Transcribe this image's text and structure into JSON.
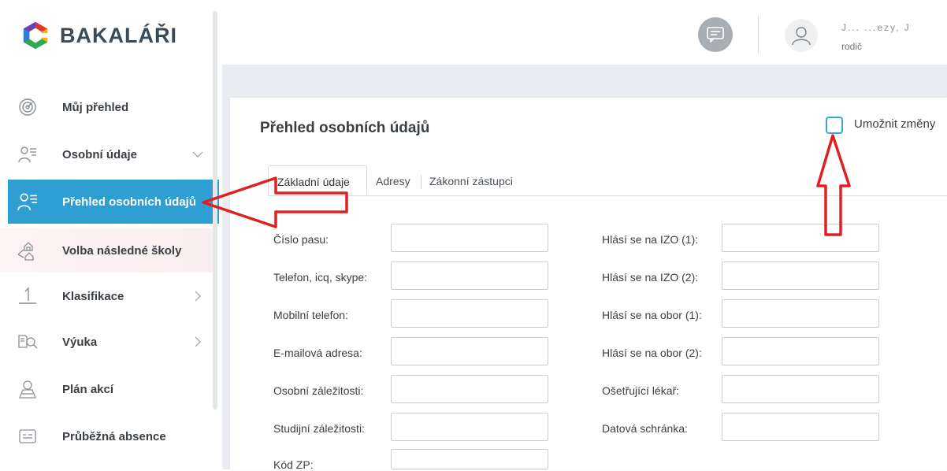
{
  "app": {
    "logo_text": "BAKALÁŘI"
  },
  "sidebar": {
    "items": [
      {
        "label": "Můj přehled",
        "icon": "gauge-icon"
      },
      {
        "label": "Osobní údaje",
        "icon": "person-list-icon"
      },
      {
        "label": "Přehled osobních údajů",
        "icon": "person-list-icon"
      },
      {
        "label": "Volba následné školy",
        "icon": "school-choice-icon"
      },
      {
        "label": "Klasifikace",
        "icon": "grade-one-icon"
      },
      {
        "label": "Výuka",
        "icon": "book-search-icon"
      },
      {
        "label": "Plán akcí",
        "icon": "event-map-icon"
      },
      {
        "label": "Průběžná absence",
        "icon": "absence-card-icon"
      }
    ]
  },
  "header": {
    "user_name": "J... ...ezy, J",
    "user_role": "rodič"
  },
  "card": {
    "title": "Přehled osobních údajů",
    "allow_changes_label": "Umožnit změny",
    "tabs": [
      "Základní údaje",
      "Adresy",
      "Zákonní zástupci"
    ]
  },
  "form": {
    "left": [
      {
        "label": "Číslo pasu:",
        "value": ""
      },
      {
        "label": "Telefon, icq, skype:",
        "value": ""
      },
      {
        "label": "Mobilní telefon:",
        "value": ""
      },
      {
        "label": "E-mailová adresa:",
        "value": ""
      },
      {
        "label": "Osobní záležitosti:",
        "value": ""
      },
      {
        "label": "Studijní záležitosti:",
        "value": ""
      },
      {
        "label": "Kód ZP:",
        "value": ""
      }
    ],
    "right": [
      {
        "label": "Hlásí se na IZO (1):",
        "value": ""
      },
      {
        "label": "Hlásí se na IZO (2):",
        "value": ""
      },
      {
        "label": "Hlásí se na obor (1):",
        "value": ""
      },
      {
        "label": "Hlásí se na obor (2):",
        "value": ""
      },
      {
        "label": "Ošetřující lékař:",
        "value": ""
      },
      {
        "label": "Datová schránka:",
        "value": ""
      }
    ]
  },
  "colors": {
    "accent": "#2e9fd3",
    "annotation": "#e02020",
    "content_bg": "#e9edf1"
  }
}
